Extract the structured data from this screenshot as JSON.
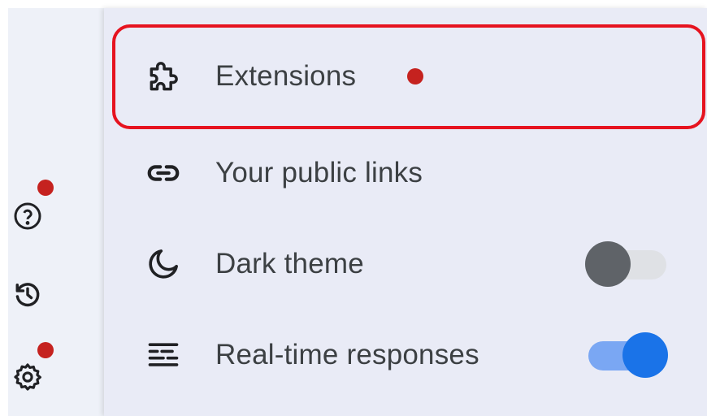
{
  "sidebar": {
    "icons": [
      "help-icon",
      "history-icon",
      "settings-icon"
    ]
  },
  "menu": {
    "items": [
      {
        "label": "Extensions",
        "icon": "puzzle-icon",
        "has_dot": true
      },
      {
        "label": "Your public links",
        "icon": "link-icon"
      },
      {
        "label": "Dark theme",
        "icon": "moon-icon",
        "toggle": "off"
      },
      {
        "label": "Real-time responses",
        "icon": "realtime-icon",
        "toggle": "on"
      }
    ]
  },
  "colors": {
    "highlight": "#e6131f",
    "notification": "#c5221f",
    "toggle_on": "#1a73e8",
    "toggle_off": "#5f6368"
  }
}
